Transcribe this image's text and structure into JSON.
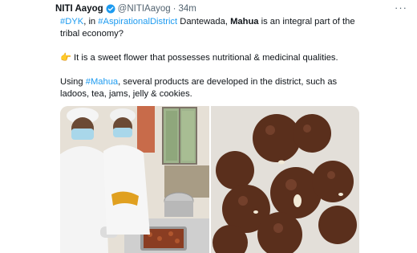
{
  "tweet": {
    "author_name": "NITI Aayog",
    "handle": "@NITIAayog",
    "separator": "·",
    "time": "34m",
    "more_label": "···",
    "line1": {
      "hashtag_dyk": "#DYK",
      "in": ", in ",
      "hashtag_district": "#AspirationalDistrict",
      "place": " Dantewada, ",
      "bold_word": "Mahua",
      "rest": " is an integral part of the"
    },
    "line2": "tribal economy?",
    "line3_emoji": "👉",
    "line3": " It is a sweet flower that possesses nutritional & medicinal qualities.",
    "line4": {
      "prefix": "Using ",
      "hashtag_mahua": "#Mahua",
      "rest": ", several products are developed in the district, such as"
    },
    "line5": "ladoos, tea, jams, jelly & cookies."
  },
  "colors": {
    "link": "#1d9bf0",
    "verified": "#1d9bf0",
    "muted": "#536471"
  },
  "icons": {
    "verified": "verified-badge-icon",
    "more": "more-options-icon"
  }
}
